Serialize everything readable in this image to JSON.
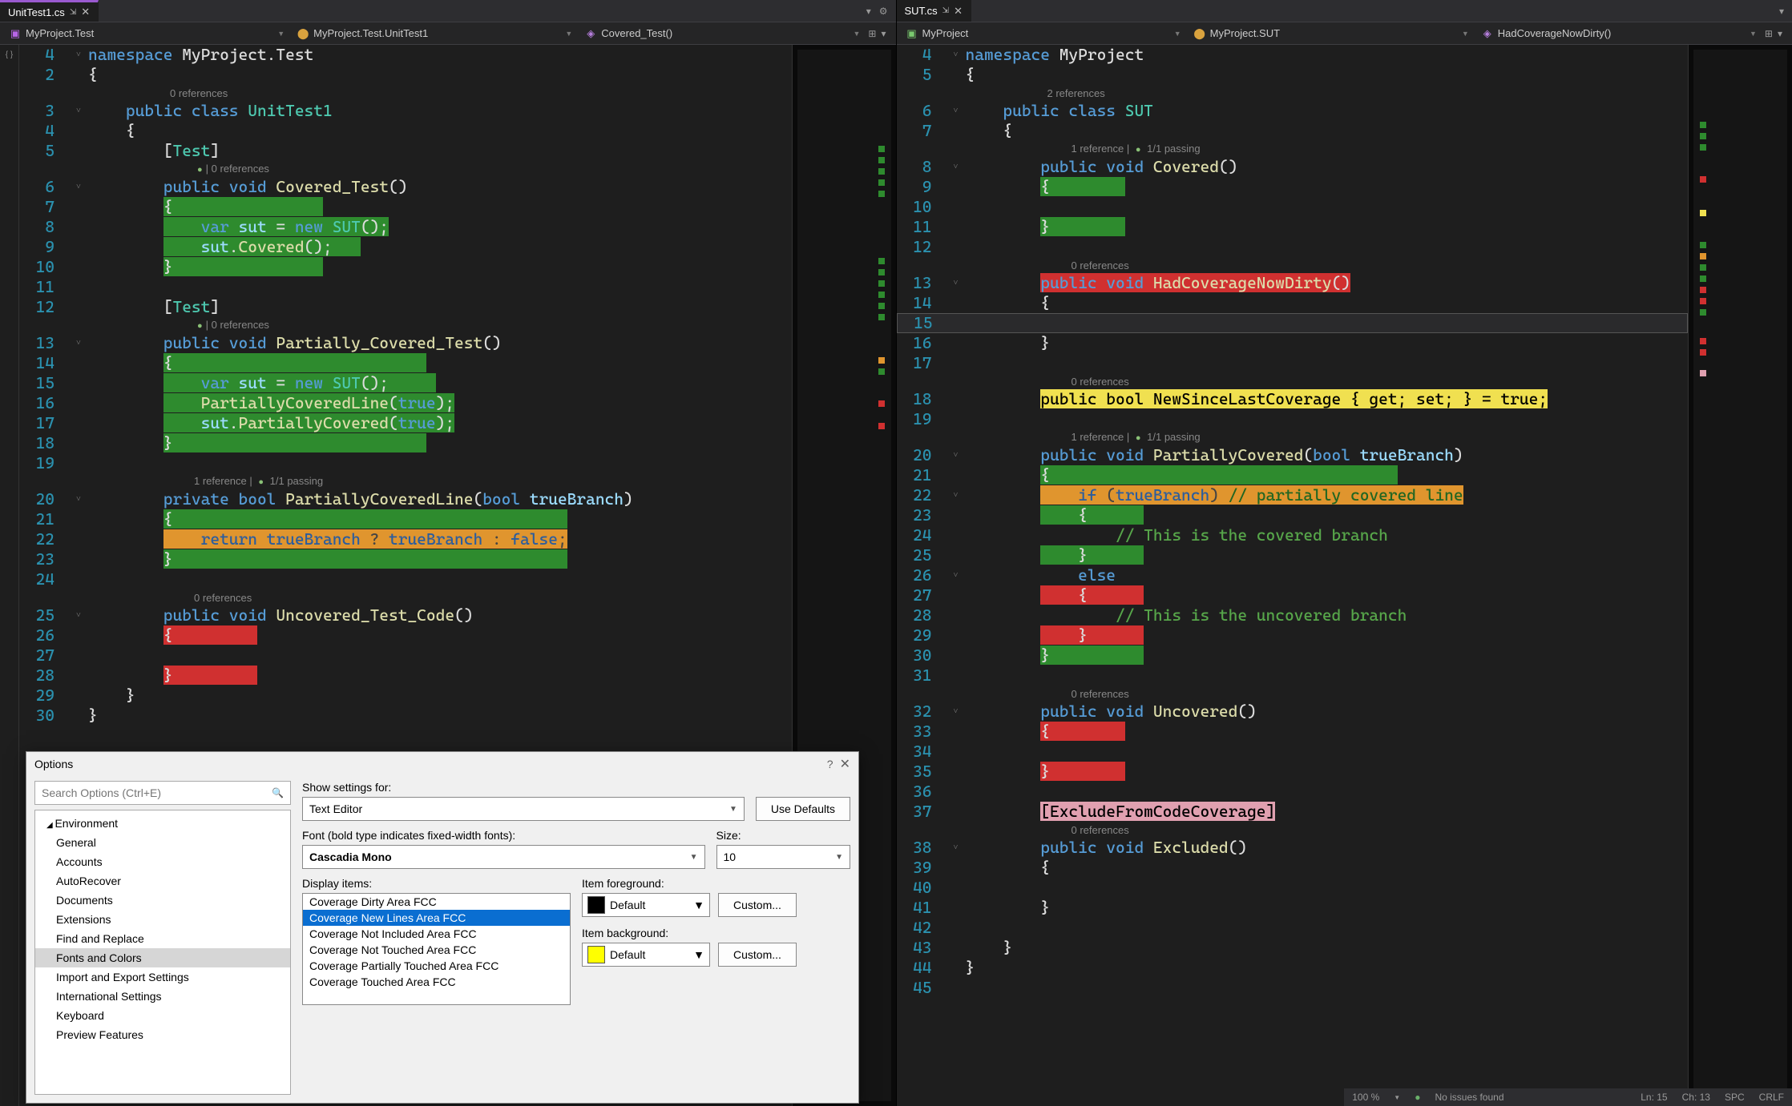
{
  "tabs": {
    "left": {
      "title": "UnitTest1.cs"
    },
    "right": {
      "title": "SUT.cs"
    }
  },
  "nav": {
    "left": {
      "project": "MyProject.Test",
      "class": "MyProject.Test.UnitTest1",
      "method": "Covered_Test()"
    },
    "right": {
      "project": "MyProject",
      "class": "MyProject.SUT",
      "method": "HadCoverageNowDirty()"
    }
  },
  "codelens": {
    "zeroRef": "0 references",
    "twoRef": "2 references",
    "oneRefPass": "1 reference | ",
    "passGlyph": "●",
    "onePassing": " 1/1 passing"
  },
  "leftCode": {
    "ln4": "namespace MyProject.Test",
    "ln_open": "{",
    "ln_close": "}",
    "classDecl_pre": "    public class ",
    "classDecl_name": "UnitTest1",
    "testAttr": "        [Test]",
    "coveredSig_pre": "        public void ",
    "coveredSig_name": "Covered_Test",
    "braceOpenI3": "        {",
    "varSut": "            var sut = new SUT();",
    "sutCovered": "            sut.Covered();",
    "braceCloseI3": "        }",
    "partialSig_name": "Partially_Covered_Test",
    "partialLine": "            PartiallyCoveredLine(true);",
    "sutPartial": "            sut.PartiallyCovered(true);",
    "pclSig": "        private bool PartiallyCoveredLine(bool trueBranch)",
    "returnLine": "            return trueBranch ? trueBranch : false;",
    "uncovSig_name": "Uncovered_Test_Code",
    "ns_close": "}"
  },
  "rightCode": {
    "ns": "namespace MyProject",
    "classDecl": "    public class SUT",
    "coveredSig": "        public void Covered()",
    "hadCovSig": "        public void HadCoverageNowDirty()",
    "newSince": "        public bool NewSinceLastCoverage { get; set; } = true;",
    "partialSig": "        public void PartiallyCovered(bool trueBranch)",
    "ifLine": "            if (trueBranch) // partially covered line",
    "comCovered": "                // This is the covered branch",
    "elseLine": "            else",
    "comUncovered": "                // This is the uncovered branch",
    "uncovSig": "        public void Uncovered()",
    "exclAttr": "        [ExcludeFromCodeCoverage]",
    "exclSig": "        public void Excluded()",
    "braceO3": "        {",
    "braceC3": "        }",
    "braceO4": "            {",
    "braceC4": "            }",
    "braceC2": "    }",
    "braceO2": "    {"
  },
  "options": {
    "title": "Options",
    "searchPlaceholder": "Search Options (Ctrl+E)",
    "tree": [
      "Environment",
      "General",
      "Accounts",
      "AutoRecover",
      "Documents",
      "Extensions",
      "Find and Replace",
      "Fonts and Colors",
      "Import and Export Settings",
      "International Settings",
      "Keyboard",
      "Preview Features"
    ],
    "showSettingsLabel": "Show settings for:",
    "showSettingsValue": "Text Editor",
    "useDefaults": "Use Defaults",
    "fontLabel": "Font (bold type indicates fixed-width fonts):",
    "fontValue": "Cascadia Mono",
    "sizeLabel": "Size:",
    "sizeValue": "10",
    "displayItemsLabel": "Display items:",
    "displayItems": [
      "Coverage Dirty Area FCC",
      "Coverage New Lines Area FCC",
      "Coverage Not Included Area FCC",
      "Coverage Not Touched Area FCC",
      "Coverage Partially Touched Area FCC",
      "Coverage Touched Area FCC"
    ],
    "fgLabel": "Item foreground:",
    "fgValue": "Default",
    "bgLabel": "Item background:",
    "bgValue": "Default",
    "customBtn": "Custom...",
    "fgColor": "#000000",
    "bgColor": "#ffff00"
  },
  "status": {
    "zoom": "100 %",
    "noIssues": "No issues found",
    "ln": "Ln: 15",
    "ch": "Ch: 13",
    "spc": "SPC",
    "crlf": "CRLF"
  }
}
